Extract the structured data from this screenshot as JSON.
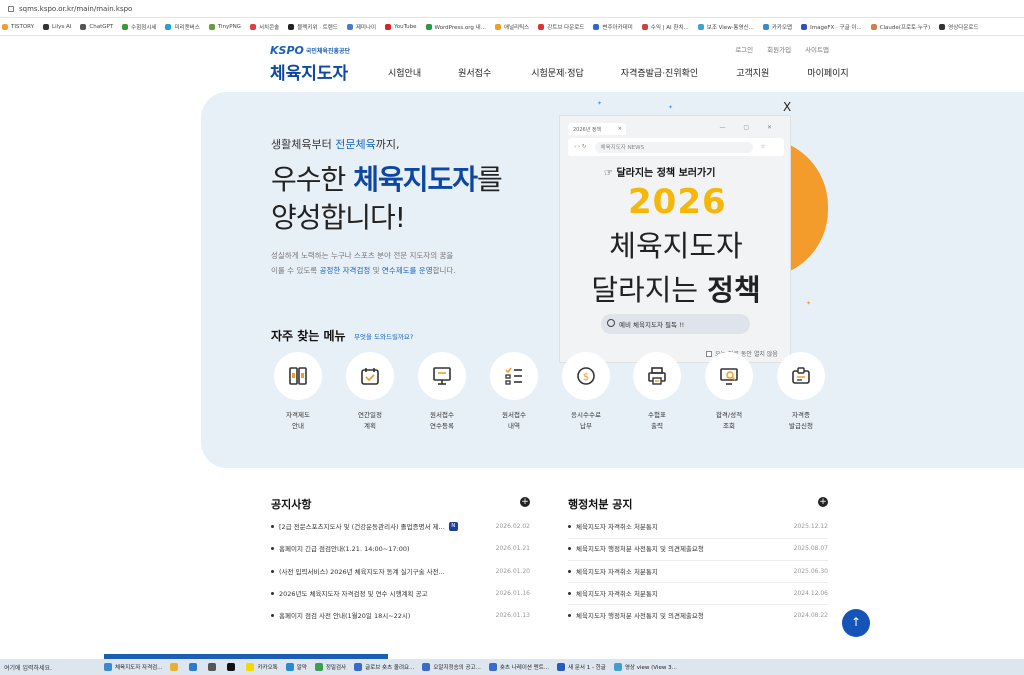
{
  "browser": {
    "url": "sqms.kspo.or.kr/main/main.kspo",
    "bookmarks": [
      {
        "label": "TISTORY",
        "color": "#f0a030"
      },
      {
        "label": "Lilys AI",
        "color": "#333333"
      },
      {
        "label": "ChatGPT",
        "color": "#555555"
      },
      {
        "label": "수험점시세",
        "color": "#3a9a3a"
      },
      {
        "label": "미리캔버스",
        "color": "#2aa0d0"
      },
      {
        "label": "TinyPNG",
        "color": "#6a9a3a"
      },
      {
        "label": "서치콘솔",
        "color": "#e04040"
      },
      {
        "label": "블랙키위 · 트렌드",
        "color": "#222222"
      },
      {
        "label": "제미나이",
        "color": "#4a7ad0"
      },
      {
        "label": "YouTube",
        "color": "#e02020"
      },
      {
        "label": "WordPress.org 내...",
        "color": "#2a9a40"
      },
      {
        "label": "애널리틱스",
        "color": "#f0a020"
      },
      {
        "label": "강트브 다운로드",
        "color": "#e03030"
      },
      {
        "label": "변주아카데미",
        "color": "#2a6ad0"
      },
      {
        "label": "수익 | AI 환치...",
        "color": "#d04040"
      },
      {
        "label": "보조 View·통영신...",
        "color": "#40a0d0"
      },
      {
        "label": "카카오맵",
        "color": "#3a8ad0"
      },
      {
        "label": "ImageFX · 구글 이...",
        "color": "#3050c0"
      },
      {
        "label": "Claude(프로토·누구)",
        "color": "#d08050"
      },
      {
        "label": "영상다운로드",
        "color": "#333333"
      }
    ]
  },
  "header": {
    "logo_kspo": "KSPO",
    "logo_org": "국민체육진흥공단",
    "logo_title": "체육지도자",
    "util": [
      "로그인",
      "회원가입",
      "사이트맵"
    ],
    "nav": [
      "시험안내",
      "원서접수",
      "시험문제·정답",
      "자격증발급·진위확인",
      "고객지원",
      "마이페이지"
    ]
  },
  "hero": {
    "sub_pre": "생활체육부터 ",
    "sub_hl": "전문체육",
    "sub_post": "까지,",
    "t1_pre": "우수한 ",
    "t1_bold": "체육지도자",
    "t1_post": "를",
    "t2": "양성합니다!",
    "d1": "성실하게 노력하는 누구나 스포츠 분야 전문 지도자의 꿈을",
    "d2_pre": "이룰 수 있도록 ",
    "d2_hl1": "공정한 자격검정",
    "d2_mid": " 및 ",
    "d2_hl2": "연수제도를 운영",
    "d2_post": "합니다."
  },
  "popup": {
    "close": "X",
    "tab_label": "2026년 정책",
    "tab_close": "×",
    "win_controls": "— ▢ ✕",
    "nav_controls": "‹ › ↻",
    "address": "체육지도자 NEWS",
    "star": "☆",
    "link_text": "☞ 달라지는 정책 보러가기",
    "year": "2026",
    "title1": "체육지도자",
    "title2_pre": "달라지는 ",
    "title2_bold": "정책",
    "search_text": "예비 체육지도자 필독 !!",
    "dont_show": "오늘 하루 동안 열지 않음"
  },
  "quick_menu": {
    "title": "자주 찾는 메뉴",
    "hint": "무엇을 도와드릴까요?",
    "items": [
      {
        "line1": "자격제도",
        "line2": "안내"
      },
      {
        "line1": "연간일정",
        "line2": "계획"
      },
      {
        "line1": "원서접수",
        "line2": "연수등록"
      },
      {
        "line1": "원서접수",
        "line2": "내역"
      },
      {
        "line1": "응시수수료",
        "line2": "납부"
      },
      {
        "line1": "수험표",
        "line2": "출력"
      },
      {
        "line1": "합격/성적",
        "line2": "조회"
      },
      {
        "line1": "자격증",
        "line2": "발급신청"
      }
    ]
  },
  "notices": {
    "title": "공지사항",
    "plus": "+",
    "items": [
      {
        "text": "[2급 전문스포츠지도사 및 (건강운동관리사) 졸업증명서 제...",
        "date": "2026.02.02",
        "badge": "N"
      },
      {
        "text": "홈페이지 긴급 점검안내(1.21. 14:00~17:00)",
        "date": "2026.01.21"
      },
      {
        "text": "(사전 입력서비스) 2026년 체육지도자 동계 실기구술 사전...",
        "date": "2026.01.20"
      },
      {
        "text": "2026년도 체육지도자 자격검정 및 연수 시행계획 공고",
        "date": "2026.01.16"
      },
      {
        "text": "홈페이지 점검 사전 안내(1월20일 18시~22시)",
        "date": "2026.01.13"
      }
    ]
  },
  "admin": {
    "title": "행정처분 공지",
    "plus": "+",
    "items": [
      {
        "text": "체육지도자 자격취소 처분통지",
        "date": "2025.12.12"
      },
      {
        "text": "체육지도자 행정처분 사전통지 및 의견제출요청",
        "date": "2025.08.07"
      },
      {
        "text": "체육지도자 자격취소 처분통지",
        "date": "2025.06.30"
      },
      {
        "text": "체육지도자 자격취소 처분통지",
        "date": "2024.12.06"
      },
      {
        "text": "체육지도자 행정처분 사전통지 및 의견제출요청",
        "date": "2024.08.22"
      }
    ]
  },
  "top_button": "↑",
  "taskbar": {
    "search": "여기에 입력하세요.",
    "items": [
      {
        "label": "체육지도자 자격검...",
        "color": "#3a8ad0"
      },
      {
        "label": "",
        "color": "#e8b030"
      },
      {
        "label": "",
        "color": "#2a7ad0"
      },
      {
        "label": "",
        "color": "#555555"
      },
      {
        "label": "",
        "color": "#111111"
      },
      {
        "label": "카카오톡",
        "color": "#f5d800"
      },
      {
        "label": "알약",
        "color": "#2a8ad0"
      },
      {
        "label": "정밀검사",
        "color": "#3aa050"
      },
      {
        "label": "글로브 숏츠 올려요...",
        "color": "#3a6ad0"
      },
      {
        "label": "오알지정승의 공고...",
        "color": "#3a6ad0"
      },
      {
        "label": "숏츠 나레이션 멘트...",
        "color": "#3a6ad0"
      },
      {
        "label": "새 문서 1 - 한글",
        "color": "#2a5ac0"
      },
      {
        "label": "영상 view (View 3...",
        "color": "#40a0d0"
      }
    ]
  },
  "colors": {
    "brand_blue": "#0d47a1",
    "accent_orange": "#f39c2b",
    "year_yellow": "#f5b80a",
    "hero_bg": "#e8f0f7"
  }
}
